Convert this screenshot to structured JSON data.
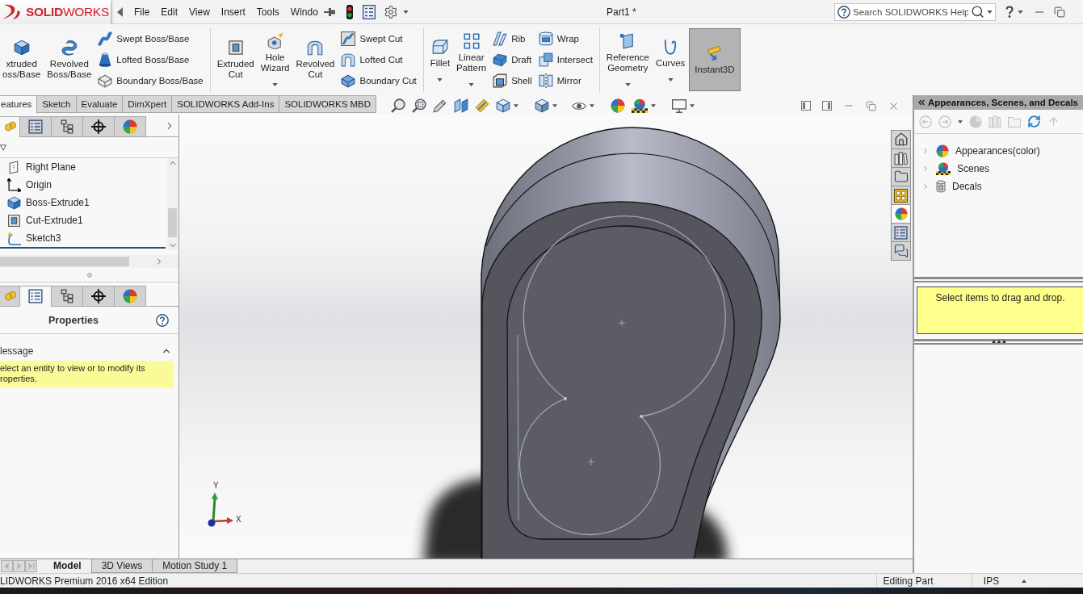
{
  "app": {
    "brand": "**SOLID**WORKS"
  },
  "menu": [
    "File",
    "Edit",
    "View",
    "Insert",
    "Tools",
    "Windo"
  ],
  "document_title": "Part1 *",
  "search": {
    "placeholder": "Search SOLIDWORKS Help"
  },
  "command_manager": {
    "groups": [
      {
        "large": [
          {
            "label_lines": [
              "xtruded",
              "oss/Base"
            ],
            "dropdown": false,
            "pressed": false
          },
          {
            "label_lines": [
              "Revolved",
              "Boss/Base"
            ],
            "dropdown": false,
            "pressed": false
          }
        ],
        "columns": [
          [
            "Swept Boss/Base",
            "Lofted Boss/Base",
            "Boundary Boss/Base"
          ]
        ]
      },
      {
        "large": [
          {
            "label_lines": [
              "Extruded",
              "Cut"
            ],
            "dropdown": false,
            "pressed": false
          },
          {
            "label_lines": [
              "Hole",
              "Wizard"
            ],
            "dropdown": true,
            "pressed": false
          },
          {
            "label_lines": [
              "Revolved",
              "Cut"
            ],
            "dropdown": false,
            "pressed": false
          }
        ],
        "columns": [
          [
            "Swept Cut",
            "Lofted Cut",
            "Boundary Cut"
          ]
        ]
      },
      {
        "large": [
          {
            "label_lines": [
              "Fillet"
            ],
            "dropdown": true,
            "pressed": false
          },
          {
            "label_lines": [
              "Linear",
              "Pattern"
            ],
            "dropdown": true,
            "pressed": false
          }
        ],
        "columns": [
          [
            "Rib",
            "Draft",
            "Shell"
          ],
          [
            "Wrap",
            "Intersect",
            "Mirror"
          ]
        ]
      },
      {
        "large": [
          {
            "label_lines": [
              "Reference",
              "Geometry"
            ],
            "dropdown": true,
            "pressed": false
          },
          {
            "label_lines": [
              "Curves"
            ],
            "dropdown": true,
            "pressed": false
          },
          {
            "label_lines": [
              "Instant3D"
            ],
            "dropdown": false,
            "pressed": true
          }
        ]
      }
    ]
  },
  "command_tabs": [
    {
      "label": "eatures",
      "selected": true
    },
    {
      "label": "Sketch",
      "selected": false
    },
    {
      "label": "Evaluate",
      "selected": false
    },
    {
      "label": "DimXpert",
      "selected": false
    },
    {
      "label": "SOLIDWORKS Add-Ins",
      "selected": false
    },
    {
      "label": "SOLIDWORKS MBD",
      "selected": false
    }
  ],
  "feature_manager": {
    "tabs": [
      {
        "selected": true
      },
      {
        "selected": false
      },
      {
        "selected": false
      },
      {
        "selected": false
      },
      {
        "selected": false
      }
    ],
    "tree": [
      {
        "label": "Right Plane"
      },
      {
        "label": "Origin"
      },
      {
        "label": "Boss-Extrude1"
      },
      {
        "label": "Cut-Extrude1"
      },
      {
        "label": "Sketch3"
      }
    ]
  },
  "property_manager": {
    "tabs": [
      {
        "selected": false
      },
      {
        "selected": true
      },
      {
        "selected": false
      },
      {
        "selected": false
      },
      {
        "selected": false
      }
    ],
    "title": "Properties",
    "section": {
      "title": "lessage",
      "expanded": true,
      "message_lines": [
        "elect an entity to view or to modify its",
        "roperties."
      ]
    }
  },
  "viewport": {
    "axis_labels": [
      "Y",
      "X"
    ]
  },
  "task_tabs": [
    {
      "selected": false
    },
    {
      "selected": false
    },
    {
      "selected": false
    },
    {
      "selected": false
    },
    {
      "selected": true
    },
    {
      "selected": false
    },
    {
      "selected": false
    }
  ],
  "task_pane": {
    "title": "Appearances, Scenes, and Decals",
    "tree": [
      {
        "label": "Appearances(color)",
        "expanded": false
      },
      {
        "label": "Scenes",
        "expanded": false
      },
      {
        "label": "Decals",
        "expanded": false
      }
    ],
    "hint": "Select items to drag and drop."
  },
  "bottom_tabs": [
    {
      "label": "Model",
      "selected": true
    },
    {
      "label": "3D Views",
      "selected": false
    },
    {
      "label": "Motion Study 1",
      "selected": false
    }
  ],
  "status_bar": {
    "edition": "LIDWORKS Premium 2016 x64 Edition",
    "mode": "Editing Part",
    "units": "IPS"
  }
}
